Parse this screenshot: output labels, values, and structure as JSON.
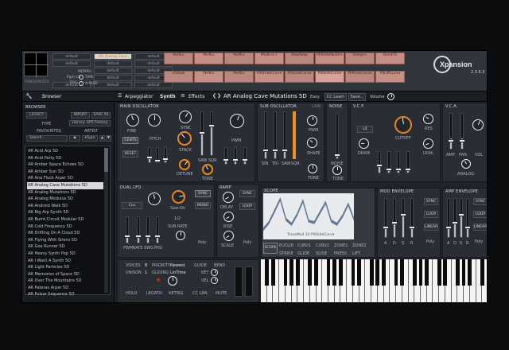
{
  "colors": {
    "accent": "#f08d22",
    "macro": "#b9877e",
    "selected_preset": "#d07b18"
  },
  "top_bank": {
    "randomizer_label": "RANDOMIZER",
    "morph_label": "MORPH",
    "pgm_ch_label": "Pgm Ch",
    "time_label": "TIME",
    "trig_label": "TRIG",
    "xfade_label": "X-FADE",
    "presets": [
      "default",
      "default",
      "default",
      "default",
      "default",
      "default",
      "default",
      "default",
      "default",
      "default",
      "default",
      "default",
      "default",
      "default",
      "default"
    ],
    "selected_preset": "AR Analog Cave Mutat",
    "macros_row1": [
      "PerfEv",
      "PerfEv",
      "PerfEv",
      "ModEnv+",
      "StepSeqs",
      "PllSlideAbsDrv",
      "Ramp+",
      "BandTb"
    ],
    "macros_row2": [
      "LfoSub",
      "PerfEv",
      "PerfEv",
      "PllStrikeCurve",
      "PllGlideCurve",
      "PllSlideCurve",
      "PllPressCurve",
      "PllLiftCurve"
    ]
  },
  "logo": {
    "name": "Xpansion",
    "version": "2.3.6.3"
  },
  "toolbar": {
    "browser_tab": "Browser",
    "arpeggiator_tab": "Arpeggiator",
    "synth_tab": "Synth",
    "effects_tab": "Effects",
    "preset_name": "AR Analog Cave Mutations 5D",
    "easy_label": "Easy",
    "cc_learn": "CC Learn",
    "save": "Save...",
    "volume": "Volume"
  },
  "browser": {
    "title": "BROWSER",
    "legacy": "LEGACY",
    "import": "IMPORT",
    "save_as": "SAVE AS",
    "type_header": "TYPE",
    "library": "Library: AP5 Factory",
    "favourites": "FAVOURITES",
    "artist": "ARTIST",
    "search": "Search...",
    "type_dropdown": "Type",
    "items": [
      "AR Acid Arp 5D",
      "AR Acid Party 5D",
      "AR Amber Space Echoes 5D",
      "AR Amber Sun 5D",
      "AR Ana Fluck Arper 5D",
      "AR Analog Cave Mutations 5D",
      "AR Analog Mutations 5D",
      "AR Analog Modulus 5D",
      "AR Android Walk 5D",
      "AR Big Arp Synth 5D",
      "AR Burnt Circuit Modular 5D",
      "AR Cold Frequency 5D",
      "AR Drifting On A Cloud 5D",
      "AR Flying With Sirens 5D",
      "AR Goa Runner 5D",
      "AR Heavy Synth Pop 5D",
      "AR I Want A Synth 5D",
      "AR Light Particles 5D",
      "AR Memories of Space 5D",
      "AR Over The Mountains 5D",
      "AR Pateras Arper 5D",
      "AR Pulsar Sequence 5D"
    ],
    "selected_index": 5
  },
  "main_osc": {
    "title": "MAIN OSCILLATOR",
    "fine": "FINE",
    "pitch": "PITCH",
    "sync": "SYNC",
    "cents": "CENTS",
    "stack": "STACK",
    "reset": "RESET",
    "detune": "DETUNE",
    "saw": "SAW",
    "sqr": "SQR",
    "pwm": "PWM",
    "tone": "TONE"
  },
  "sub_osc": {
    "title": "SUB OSCILLATOR",
    "link": "LINK",
    "sin": "SIN",
    "tri": "TRI",
    "saw": "SAW",
    "sqr": "SQR",
    "pwm": "PWM",
    "shape": "SHAPE",
    "tone": "TONE"
  },
  "noise": {
    "title": "NOISE",
    "noise": "NOISE",
    "tone": "TONE"
  },
  "vcf": {
    "title": "V.C.F.",
    "mode": "L4",
    "cutoff": "CUTOFF",
    "res": "RES",
    "drive": "DRIVE",
    "leak": "LEAK"
  },
  "vca": {
    "title": "V.C.A.",
    "amp": "AMP",
    "pan": "PAN",
    "vol": "VOL",
    "analog": "ANALOG"
  },
  "lfo": {
    "title": "DUAL LFO",
    "cos": "Cos",
    "sync": "SYNC",
    "sawdn": "Saw-Dn",
    "mono": "MONO",
    "ratio": "1/2",
    "subrate": "SUB RATE",
    "pwm": "PWM",
    "rate": "RATE",
    "swg": "SWG",
    "phs": "PHS",
    "poly": "Poly"
  },
  "ramp": {
    "title": "RAMP",
    "sync": "SYNC",
    "delay": "DELAY",
    "loop": "LOOP",
    "rise": "RISE",
    "scale": "SCALE",
    "poly": "Poly"
  },
  "scope": {
    "title": "SCOPE",
    "caption": "TransMod 14  PllSlideCurve",
    "button": "SCOPE",
    "row1": [
      "EUCLID",
      "CURV1",
      "CURV2",
      "ZONE1",
      "ZONE2"
    ],
    "row2": [
      "STRIKE",
      "GLIDE",
      "SLIDE",
      "PRESS",
      "LIFT"
    ]
  },
  "mod_env": {
    "title": "MOD ENVELOPE",
    "sync": "SYNC",
    "loop": "LOOP",
    "linear": "LINEAR",
    "poly": "Poly",
    "adsr": [
      "A",
      "D",
      "S",
      "R"
    ]
  },
  "amp_env": {
    "title": "AMP ENVELOPE",
    "sync": "SYNC",
    "loop": "LOOP",
    "linear": "LINEAR",
    "poly": "Poly",
    "adsr": [
      "A",
      "D",
      "S",
      "R"
    ]
  },
  "voice": {
    "voices_label": "VOICES",
    "voices": "8",
    "priority_label": "PRIORITY",
    "priority": "Newest",
    "guide": "GUIDE",
    "bend": "BEND",
    "unison_label": "UNISON",
    "unison": "1",
    "gliding_label": "GLIDING",
    "gliding": "LinTime",
    "key": "KEY",
    "vel": "VEL",
    "hold": "HOLD",
    "legato": "LEGATO",
    "retrig": "RETRIG",
    "cc_lrn": "CC LRN",
    "mute": "MUTE"
  },
  "scope_wave": [
    0.05,
    0.25,
    0.6,
    0.95,
    0.35,
    0.2,
    0.5,
    0.9,
    0.3,
    0.25,
    0.55,
    0.85,
    0.3,
    0.2,
    0.45,
    0.8,
    0.35
  ]
}
